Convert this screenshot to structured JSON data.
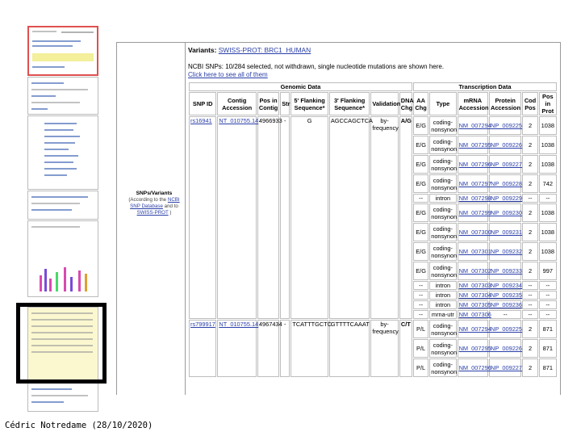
{
  "variants": {
    "label": "Variants:",
    "value": "SWISS-PROT: BRC1_HUMAN"
  },
  "ncbi_note": "NCBI SNPs: 10/284 selected, not withdrawn, single nucleotide mutations are shown here.",
  "see_all_link": "Click here to see all of them",
  "section": {
    "title": "SNPs/Variants",
    "note_prefix": "(According to the",
    "ncbi_link": "NCBI SNP Database",
    "and_text": "and to",
    "swiss_link": "SWISS-PROT",
    "note_suffix": ")"
  },
  "groups": {
    "genomic": "Genomic Data",
    "transcription": "Transcription Data"
  },
  "headers": {
    "snp_id": "SNP ID",
    "contig": "Contig Accession",
    "pos_contig": "Pos in Contig",
    "str": "Str",
    "flank5": "5' Flanking Sequence*",
    "flank3": "3' Flanking Sequence*",
    "validation": "Validation",
    "dna_chg": "DNA Chg",
    "aa_chg": "AA Chg",
    "type": "Type",
    "mrna": "mRNA Accession",
    "protein": "Protein Accession",
    "cod_pos": "Cod Pos",
    "pos_prot": "Pos in Prot"
  },
  "snps": [
    {
      "snp_id": "rs16941",
      "contig": "NT_010755.14",
      "pos": "4966933",
      "str": "-",
      "flank5": "G",
      "flank3": "AGCCAGCTCA",
      "validation": "by-frequency",
      "dna": "A/G",
      "rows": [
        {
          "aa": "E/G",
          "type": "coding-nonsynon",
          "mrna": "NM_007294",
          "prot": "NP_009225",
          "cod": "2",
          "pp": "1038"
        },
        {
          "aa": "E/G",
          "type": "coding-nonsynon",
          "mrna": "NM_007295",
          "prot": "NP_009226",
          "cod": "2",
          "pp": "1038"
        },
        {
          "aa": "E/G",
          "type": "coding-nonsynon",
          "mrna": "NM_007296",
          "prot": "NP_009227",
          "cod": "2",
          "pp": "1038"
        },
        {
          "aa": "E/G",
          "type": "coding-nonsynon",
          "mrna": "NM_007297",
          "prot": "NP_009228",
          "cod": "2",
          "pp": "742"
        },
        {
          "aa": "--",
          "type": "intron",
          "mrna": "NM_007298",
          "prot": "NP_009229",
          "cod": "--",
          "pp": "--"
        },
        {
          "aa": "E/G",
          "type": "coding-nonsynon",
          "mrna": "NM_007299",
          "prot": "NP_009230",
          "cod": "2",
          "pp": "1038"
        },
        {
          "aa": "E/G",
          "type": "coding-nonsynon",
          "mrna": "NM_007300",
          "prot": "NP_009231",
          "cod": "2",
          "pp": "1038"
        },
        {
          "aa": "E/G",
          "type": "coding-nonsynon",
          "mrna": "NM_007301",
          "prot": "NP_009232",
          "cod": "2",
          "pp": "1038"
        },
        {
          "aa": "E/G",
          "type": "coding-nonsynon",
          "mrna": "NM_007302",
          "prot": "NP_009233",
          "cod": "2",
          "pp": "997"
        },
        {
          "aa": "--",
          "type": "intron",
          "mrna": "NM_007303",
          "prot": "NP_009234",
          "cod": "--",
          "pp": "--"
        },
        {
          "aa": "--",
          "type": "intron",
          "mrna": "NM_007304",
          "prot": "NP_009235",
          "cod": "--",
          "pp": "--"
        },
        {
          "aa": "--",
          "type": "intron",
          "mrna": "NM_007305",
          "prot": "NP_009236",
          "cod": "--",
          "pp": "--"
        },
        {
          "aa": "--",
          "type": "mrna-utr",
          "mrna": "NM_007306",
          "prot": "--",
          "cod": "--",
          "pp": "--"
        }
      ]
    },
    {
      "snp_id": "rs799917",
      "contig": "NT_010755.14",
      "pos": "4967434",
      "str": "-",
      "flank5": "TCATTTGCTC",
      "flank3": "GTTTTCAAAT",
      "validation": "by-frequency",
      "dna": "C/T",
      "rows": [
        {
          "aa": "P/L",
          "type": "coding-nonsynon",
          "mrna": "NM_007294",
          "prot": "NP_009225",
          "cod": "2",
          "pp": "871"
        },
        {
          "aa": "P/L",
          "type": "coding-nonsynon",
          "mrna": "NM_007295",
          "prot": "NP_009226",
          "cod": "2",
          "pp": "871"
        },
        {
          "aa": "P/L",
          "type": "coding-nonsynon",
          "mrna": "NM_007296",
          "prot": "NP_009227",
          "cod": "2",
          "pp": "871"
        }
      ]
    }
  ],
  "footer": "Cédric Notredame (28/10/2020)"
}
